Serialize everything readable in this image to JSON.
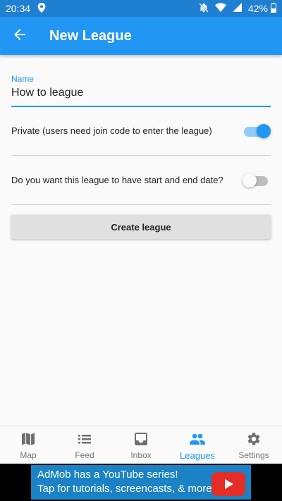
{
  "status_bar": {
    "time": "20:34",
    "battery": "42%",
    "icons": [
      "location-icon",
      "mute-bell-icon",
      "wifi-icon",
      "signal-icon",
      "battery-icon"
    ]
  },
  "app_bar": {
    "title": "New League",
    "back_icon": "arrow-left-icon",
    "color": "#2196f3"
  },
  "form": {
    "name_label": "Name",
    "name_value": "How to league",
    "private_label": "Private (users need join code to enter the league)",
    "private_on": true,
    "dates_label": "Do you want this league to have start and end date?",
    "dates_on": false,
    "create_button": "Create league"
  },
  "bottom_nav": {
    "items": [
      {
        "label": "Map",
        "icon": "map-icon"
      },
      {
        "label": "Feed",
        "icon": "list-icon"
      },
      {
        "label": "Inbox",
        "icon": "inbox-icon"
      },
      {
        "label": "Leagues",
        "icon": "people-icon",
        "active": true
      },
      {
        "label": "Settings",
        "icon": "gear-icon"
      }
    ]
  },
  "ad_banner": {
    "line1": "AdMob has a YouTube series!",
    "line2": "Tap for tutorials, screencasts, & more.",
    "icon": "youtube-icon"
  }
}
